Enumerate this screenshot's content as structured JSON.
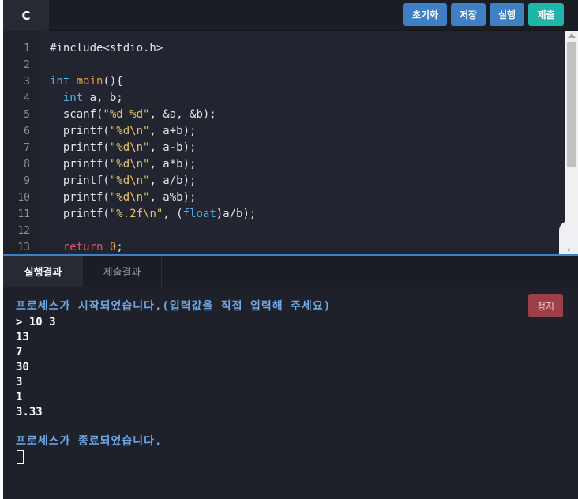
{
  "header": {
    "language_tab": "C",
    "buttons": {
      "reset": "초기화",
      "save": "저장",
      "run": "실행",
      "submit": "제출"
    }
  },
  "editor": {
    "line_numbers": [
      "1",
      "2",
      "3",
      "4",
      "5",
      "6",
      "7",
      "8",
      "9",
      "10",
      "11",
      "12",
      "13"
    ],
    "lines": {
      "l1": "#include<stdio.h>",
      "l3_type": "int",
      "l3_fn": "main",
      "l3_rest": "(){",
      "l4_type": "int",
      "l4_rest": " a, b;",
      "l5_a": "scanf(",
      "l5_str": "\"%d %d\"",
      "l5_b": ", &a, &b);",
      "printf": "printf(",
      "fmt_d": "\"%d\\n\"",
      "l6_rest": ", a+b);",
      "l7_rest": ", a-b);",
      "l8_rest": ", a*b);",
      "l9_rest": ", a/b);",
      "l10_rest": ", a%b);",
      "fmt_f": "\"%.2f\\n\"",
      "l11_mid": ", (",
      "l11_float": "float",
      "l11_rest": ")a/b);",
      "l13_ret": "return",
      "l13_num": "0",
      "l13_rest": ";"
    }
  },
  "side_toggle": {
    "icon": "chevron-left-icon",
    "glyph": "‹"
  },
  "result_tabs": {
    "run_result": "실행결과",
    "submit_result": "제출결과"
  },
  "console": {
    "start_message": "프로세스가 시작되었습니다.(입력값을 직접 입력해 주세요)",
    "input_line": "> 10 3",
    "outputs": [
      "13",
      "7",
      "30",
      "3",
      "1",
      "3.33"
    ],
    "end_message": "프로세스가 종료되었습니다.",
    "stop_button": "정지"
  },
  "colors": {
    "accent_blue": "#3f7fc3",
    "submit_teal": "#1eb6a8",
    "stop_red": "#9c3f47",
    "background": "#1e2129"
  }
}
